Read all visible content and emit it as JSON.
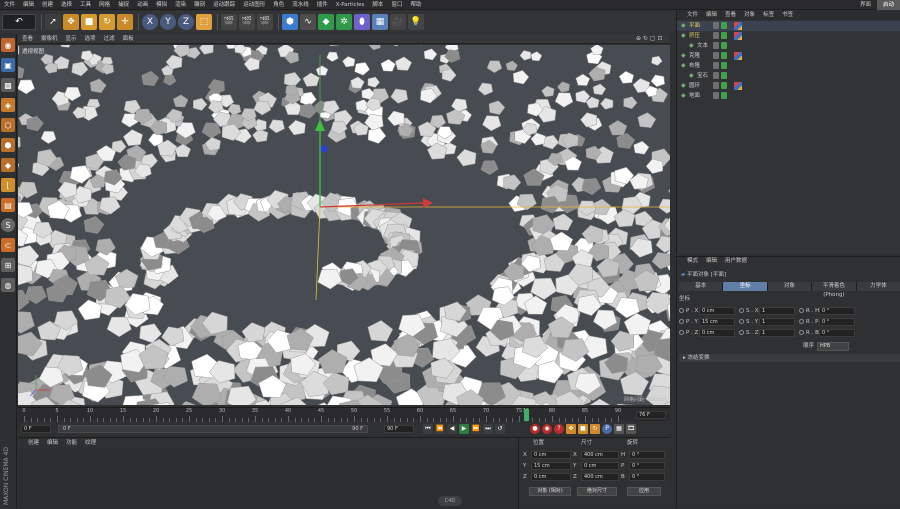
{
  "menubar": {
    "items": [
      "文件",
      "编辑",
      "创建",
      "选择",
      "工具",
      "网格",
      "捕捉",
      "动画",
      "模拟",
      "渲染",
      "雕刻",
      "运动跟踪",
      "运动图形",
      "角色",
      "流水线",
      "插件",
      "X-Particles",
      "脚本",
      "窗口",
      "帮助"
    ],
    "right": [
      "界面",
      "启动"
    ]
  },
  "toolbar": {
    "undo": "↶",
    "x": "X",
    "y": "Y",
    "z": "Z"
  },
  "viewport": {
    "menu": [
      "查看",
      "摄像机",
      "显示",
      "选项",
      "过滤",
      "面板"
    ],
    "label": "透视视图",
    "grid_label": "网格间距: 100 cm",
    "icons_right": "⊕ ↻ ▢ ⊡"
  },
  "timeline": {
    "ticks": [
      "0",
      "5",
      "10",
      "15",
      "20",
      "25",
      "30",
      "35",
      "40",
      "45",
      "50",
      "55",
      "60",
      "65",
      "70",
      "75",
      "76",
      "80",
      "85",
      "90"
    ],
    "frame_end": "90 F",
    "current": "76 F"
  },
  "timectrl": {
    "start": "0 F",
    "min": "0 F",
    "max": "90 F",
    "end": "90 F"
  },
  "bottom": {
    "menu": [
      "创建",
      "编辑",
      "功能",
      "纹理"
    ],
    "coord_headers": [
      "位置",
      "尺寸",
      "旋转"
    ],
    "rows": [
      {
        "axis": "X",
        "pos": "0 cm",
        "size": "400 cm",
        "rot_label": "H",
        "rot": "0 °"
      },
      {
        "axis": "Y",
        "pos": "15 cm",
        "size": "0 cm",
        "rot_label": "P",
        "rot": "0 °"
      },
      {
        "axis": "Z",
        "pos": "0 cm",
        "size": "400 cm",
        "rot_label": "B",
        "rot": "0 °"
      }
    ],
    "mode": "对象 (相对)",
    "size_mode": "绝对尺寸",
    "apply": "应用",
    "brand1": "MAXON",
    "brand2": "CINEMA 4D",
    "logo_text": "C4D"
  },
  "objects": {
    "tabs": [
      "文件",
      "编辑",
      "查看",
      "对象",
      "标签",
      "书签"
    ],
    "items": [
      {
        "name": "平面",
        "indent": 0,
        "color": "#e8d35a"
      },
      {
        "name": "挤压",
        "indent": 0,
        "color": "#e8d35a"
      },
      {
        "name": "文本",
        "indent": 1,
        "color": "#cfcfcf"
      },
      {
        "name": "克隆",
        "indent": 0,
        "color": "#cfcfcf"
      },
      {
        "name": "布隆",
        "indent": 0,
        "color": "#cfcfcf"
      },
      {
        "name": "宝石",
        "indent": 1,
        "color": "#cfcfcf"
      },
      {
        "name": "圆环",
        "indent": 0,
        "color": "#cfcfcf"
      },
      {
        "name": "地面",
        "indent": 0,
        "color": "#cfcfcf"
      }
    ]
  },
  "attr": {
    "tabs": [
      "模式",
      "编辑",
      "用户数据"
    ],
    "title": "平面对象 [平面]",
    "subtabs": [
      "基本",
      "坐标",
      "对象",
      "平滑着色(Phong)",
      "力学体"
    ],
    "active_subtab": 1,
    "section": "坐标",
    "fields": [
      {
        "p": "P . X",
        "pv": "0 cm",
        "s": "S . X",
        "sv": "1",
        "r": "R . H",
        "rv": "0 °"
      },
      {
        "p": "P . Y",
        "pv": "15 cm",
        "s": "S . Y",
        "sv": "1",
        "r": "R . P",
        "rv": "0 °"
      },
      {
        "p": "P . Z",
        "pv": "0 cm",
        "s": "S . Z",
        "sv": "1",
        "r": "R . B",
        "rv": "0 °"
      }
    ],
    "order_label": "顺序",
    "order_value": "HPB",
    "freeze": "冻结变换"
  },
  "colors": {
    "accent": "#5f7fa8",
    "selected_tab": "#5f7fa8",
    "cloner_bg": "#474c52"
  }
}
